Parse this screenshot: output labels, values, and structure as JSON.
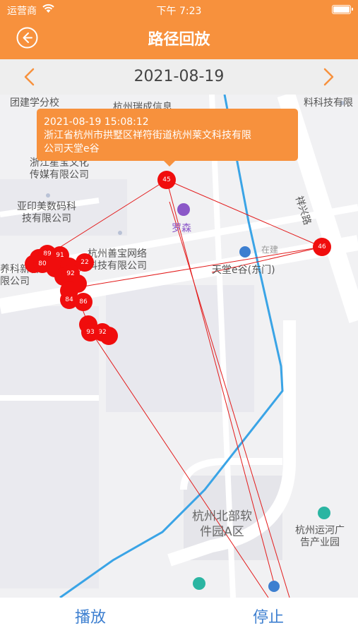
{
  "status_bar": {
    "carrier": "运营商",
    "time": "下午 7:23"
  },
  "header": {
    "title": "路径回放"
  },
  "date_nav": {
    "date": "2021-08-19"
  },
  "map": {
    "labels": {
      "school": "团建学分校",
      "tech_top": "杭州瑞成信息",
      "tech_top_right": "料科技有限",
      "culture": "浙江星宝文化\n传媒有限公司",
      "yayin": "亚印美数码科\n技有限公司",
      "luosen": "罗森",
      "shanbao": "杭州善宝网络\n科技有限公司",
      "left_company": "养科新科\n限公司",
      "tiantang": "天堂e谷(东门)",
      "xiangxing_road": "祥兴路",
      "zaijian": "在建",
      "north_park": "杭州北部软\n件园A区",
      "canal": "杭州运河广\n告产业园"
    },
    "info_window": {
      "time": "2021-08-19 15:08:12",
      "address": "浙江省杭州市拱墅区祥符街道杭州莱文科技有限\n公司天堂e谷"
    },
    "markers": [
      "45",
      "46",
      "89",
      "91",
      "80",
      "22",
      "92",
      "84",
      "86",
      "93",
      "92"
    ],
    "route_color": "#e31b1b",
    "marker_color": "#f00d0d"
  },
  "bottom_bar": {
    "play_label": "播放",
    "stop_label": "停止"
  },
  "colors": {
    "header": "#f7913d",
    "accent_text": "#3d7fd0",
    "road_blue": "#3aa4e6"
  }
}
